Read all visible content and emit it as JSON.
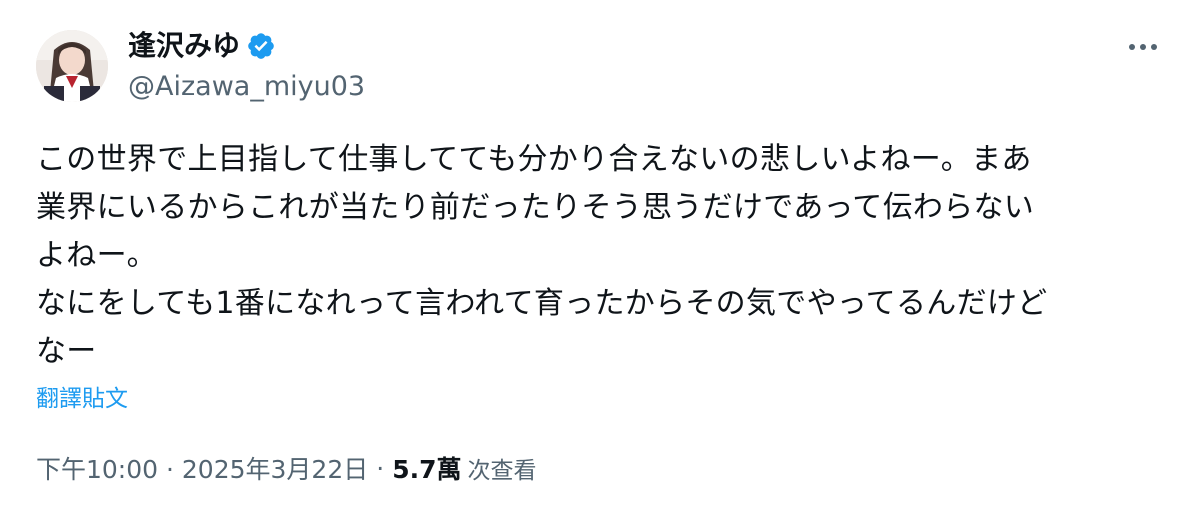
{
  "author": {
    "display_name": "逢沢みゆ",
    "handle": "@Aizawa_miyu03",
    "verified_color": "#1d9bf0"
  },
  "icons": {
    "verified": "verified-badge-icon",
    "more": "more-options-icon"
  },
  "tweet": {
    "text": "この世界で上目指して仕事してても分かり合えないの悲しいよねー。まあ\n業界にいるからこれが当たり前だったりそう思うだけであって伝わらない\nよねー。\nなにをしても1番になれって言われて育ったからその気でやってるんだけど\nなー",
    "translate_label": "翻譯貼文"
  },
  "meta": {
    "timestamp": "下午10:00 · 2025年3月22日",
    "separator": "·",
    "views_count": "5.7萬",
    "views_label": "次查看"
  },
  "colors": {
    "text_primary": "#0f1419",
    "text_secondary": "#536471",
    "link": "#1d9bf0"
  }
}
